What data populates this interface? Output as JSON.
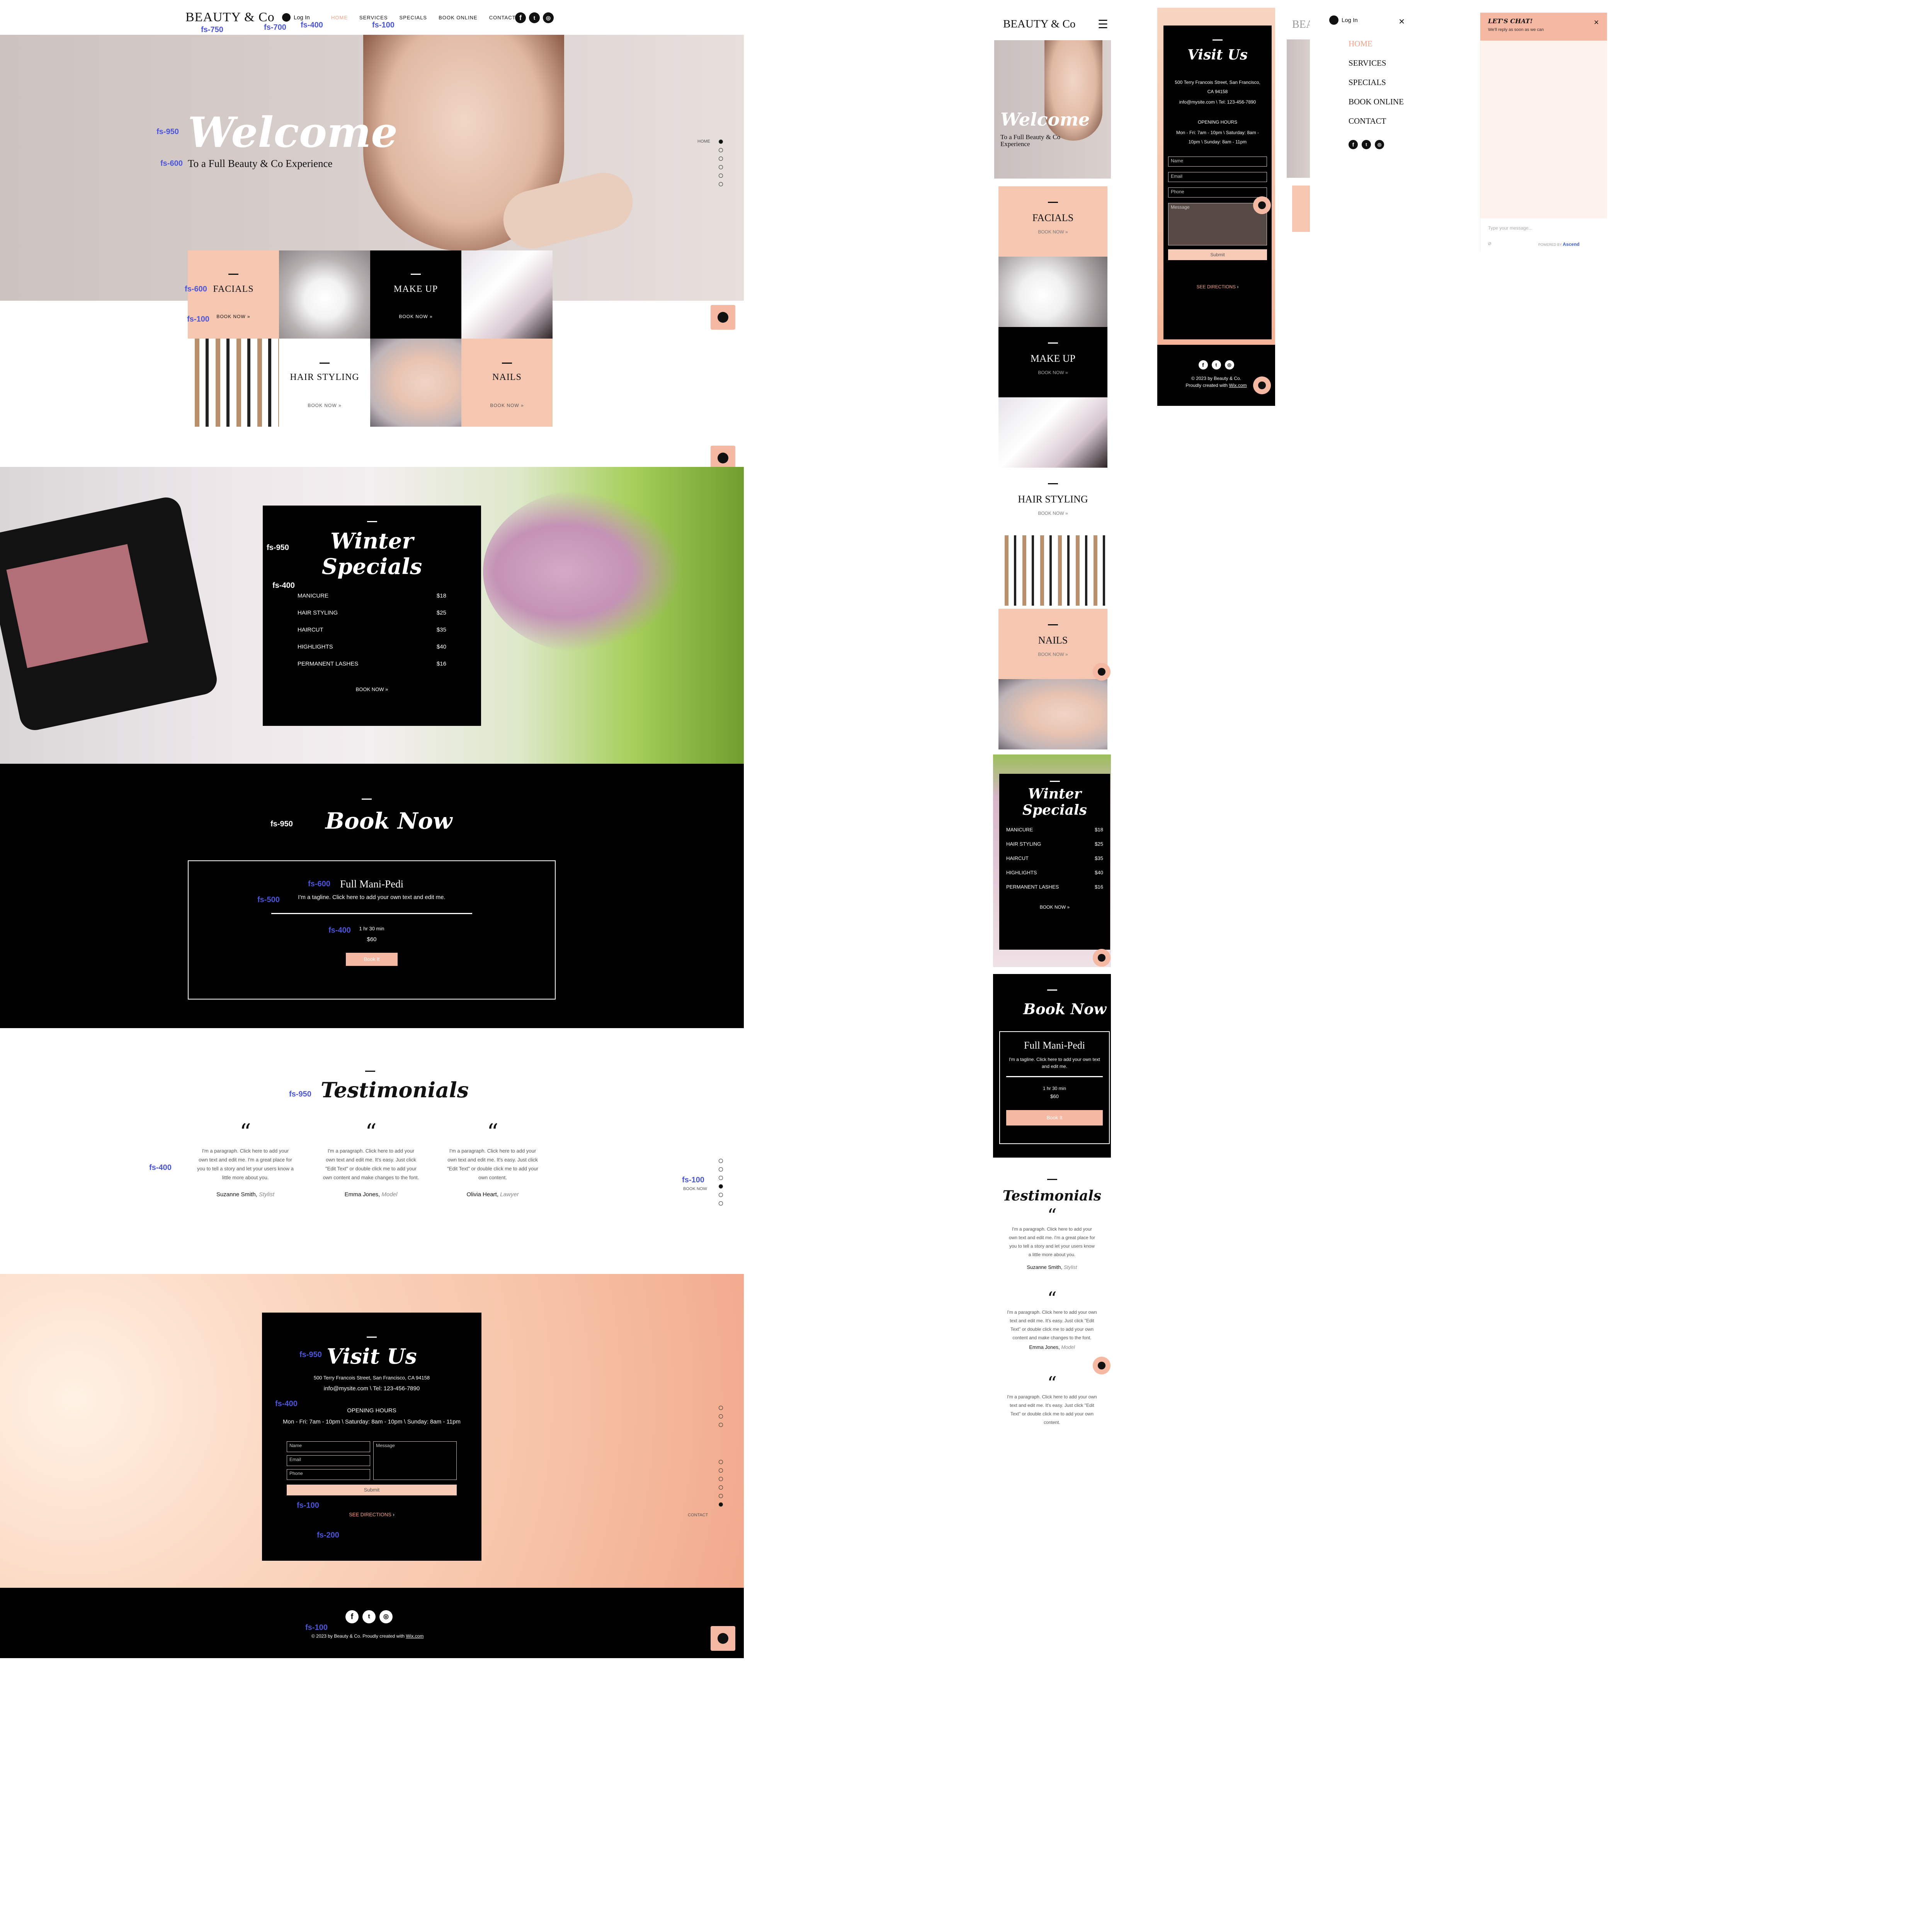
{
  "brand": "BEAUTY & Co",
  "login": "Log In",
  "nav": [
    "HOME",
    "SERVICES",
    "SPECIALS",
    "BOOK ONLINE",
    "CONTACT"
  ],
  "annotations": {
    "logo": "fs-750",
    "login": "fs-700",
    "nav_a": "fs-400",
    "nav_b": "fs-100",
    "welcome": "fs-950",
    "welcome_sub": "fs-600",
    "tile_title": "fs-600",
    "tile_btn": "fs-100",
    "specials_title": "fs-950",
    "specials_row": "fs-400",
    "book_title": "fs-950",
    "card_title": "fs-600",
    "card_tagline": "fs-500",
    "card_duration": "fs-400",
    "testimonials_title": "fs-950",
    "testimonials_text": "fs-400",
    "side_nav": "fs-100",
    "visit_title": "fs-950",
    "visit_text": "fs-400",
    "submit": "fs-100",
    "directions": "fs-200",
    "footer": "fs-100"
  },
  "hero": {
    "title": "Welcome",
    "subtitle": "To a Full Beauty & Co Experience",
    "side_label": "HOME"
  },
  "services": [
    {
      "title": "FACIALS",
      "button": "BOOK NOW »"
    },
    {
      "title": "MAKE UP",
      "button": "BOOK NOW »"
    },
    {
      "title": "HAIR STYLING",
      "button": "BOOK NOW »"
    },
    {
      "title": "NAILS",
      "button": "BOOK NOW »"
    }
  ],
  "specials": {
    "title": "Winter Specials",
    "items": [
      {
        "name": "MANICURE",
        "price": "$18"
      },
      {
        "name": "HAIR STYLING",
        "price": "$25"
      },
      {
        "name": "HAIRCUT",
        "price": "$35"
      },
      {
        "name": "HIGHLIGHTS",
        "price": "$40"
      },
      {
        "name": "PERMANENT LASHES",
        "price": "$16"
      }
    ],
    "button": "BOOK NOW »"
  },
  "booking": {
    "title": "Book Now",
    "service": "Full Mani-Pedi",
    "tagline": "I'm a tagline. Click here to add your own text and edit me.",
    "duration": "1 hr 30 min",
    "price": "$60",
    "button": "Book It"
  },
  "testimonials": {
    "title": "Testimonials",
    "side_label": "BOOK NOW",
    "items": [
      {
        "text": "I'm a paragraph. Click here to add your own text and edit me. I'm a great place for you to tell a story and let your users know a little more about you.",
        "name": "Suzanne Smith,",
        "role": "Stylist"
      },
      {
        "text": "I'm a paragraph. Click here to add your own text and edit me. It's easy. Just click \"Edit Text\" or double click me to add your own content and make changes to the font.",
        "name": "Emma Jones,",
        "role": "Model"
      },
      {
        "text": "I'm a paragraph. Click here to add your own text and edit me. It's easy. Just click \"Edit Text\" or double click me to add your own content.",
        "name": "Olivia Heart,",
        "role": "Lawyer"
      }
    ]
  },
  "visit": {
    "title": "Visit Us",
    "address": "500 Terry Francois Street, San Francisco, CA 94158",
    "contact": "info@mysite.com \\ Tel: 123-456-7890",
    "hours_label": "OPENING HOURS",
    "hours": "Mon - Fri: 7am - 10pm \\ Saturday: 8am - 10pm \\ Sunday: 8am - 11pm",
    "fields": {
      "name": "Name",
      "email": "Email",
      "phone": "Phone",
      "message": "Message"
    },
    "submit": "Submit",
    "directions": "SEE DIRECTIONS",
    "side_label": "CONTACT"
  },
  "footer": {
    "copyright": "© 2023 by Beauty & Co. Proudly created with",
    "link": "Wix.com"
  },
  "mobile": {
    "visit_address": "500 Terry Francois Street, San Francisco, CA 94158",
    "visit_contact": "info@mysite.com \\ Tel: 123-456-7890",
    "visit_hours": "Mon - Fri: 7am - 10pm \\ Saturday: 8am - 10pm \\ Sunday: 8am - 11pm",
    "footer_copyright": "© 2023 by Beauty & Co.",
    "footer_made": "Proudly created with",
    "footer_link": "Wix.com"
  },
  "menu": {
    "login": "Log In",
    "items": [
      "HOME",
      "SERVICES",
      "SPECIALS",
      "BOOK ONLINE",
      "CONTACT"
    ],
    "active_color": "#f4a185"
  },
  "chat": {
    "title": "LET'S CHAT!",
    "subtitle": "We'll reply as soon as we can",
    "placeholder": "Type your message...",
    "powered": "POWERED BY",
    "brand": "Ascend"
  },
  "colors": {
    "accent": "#f5b8a2",
    "dark": "#000000",
    "annotation": "#4a55d8"
  }
}
